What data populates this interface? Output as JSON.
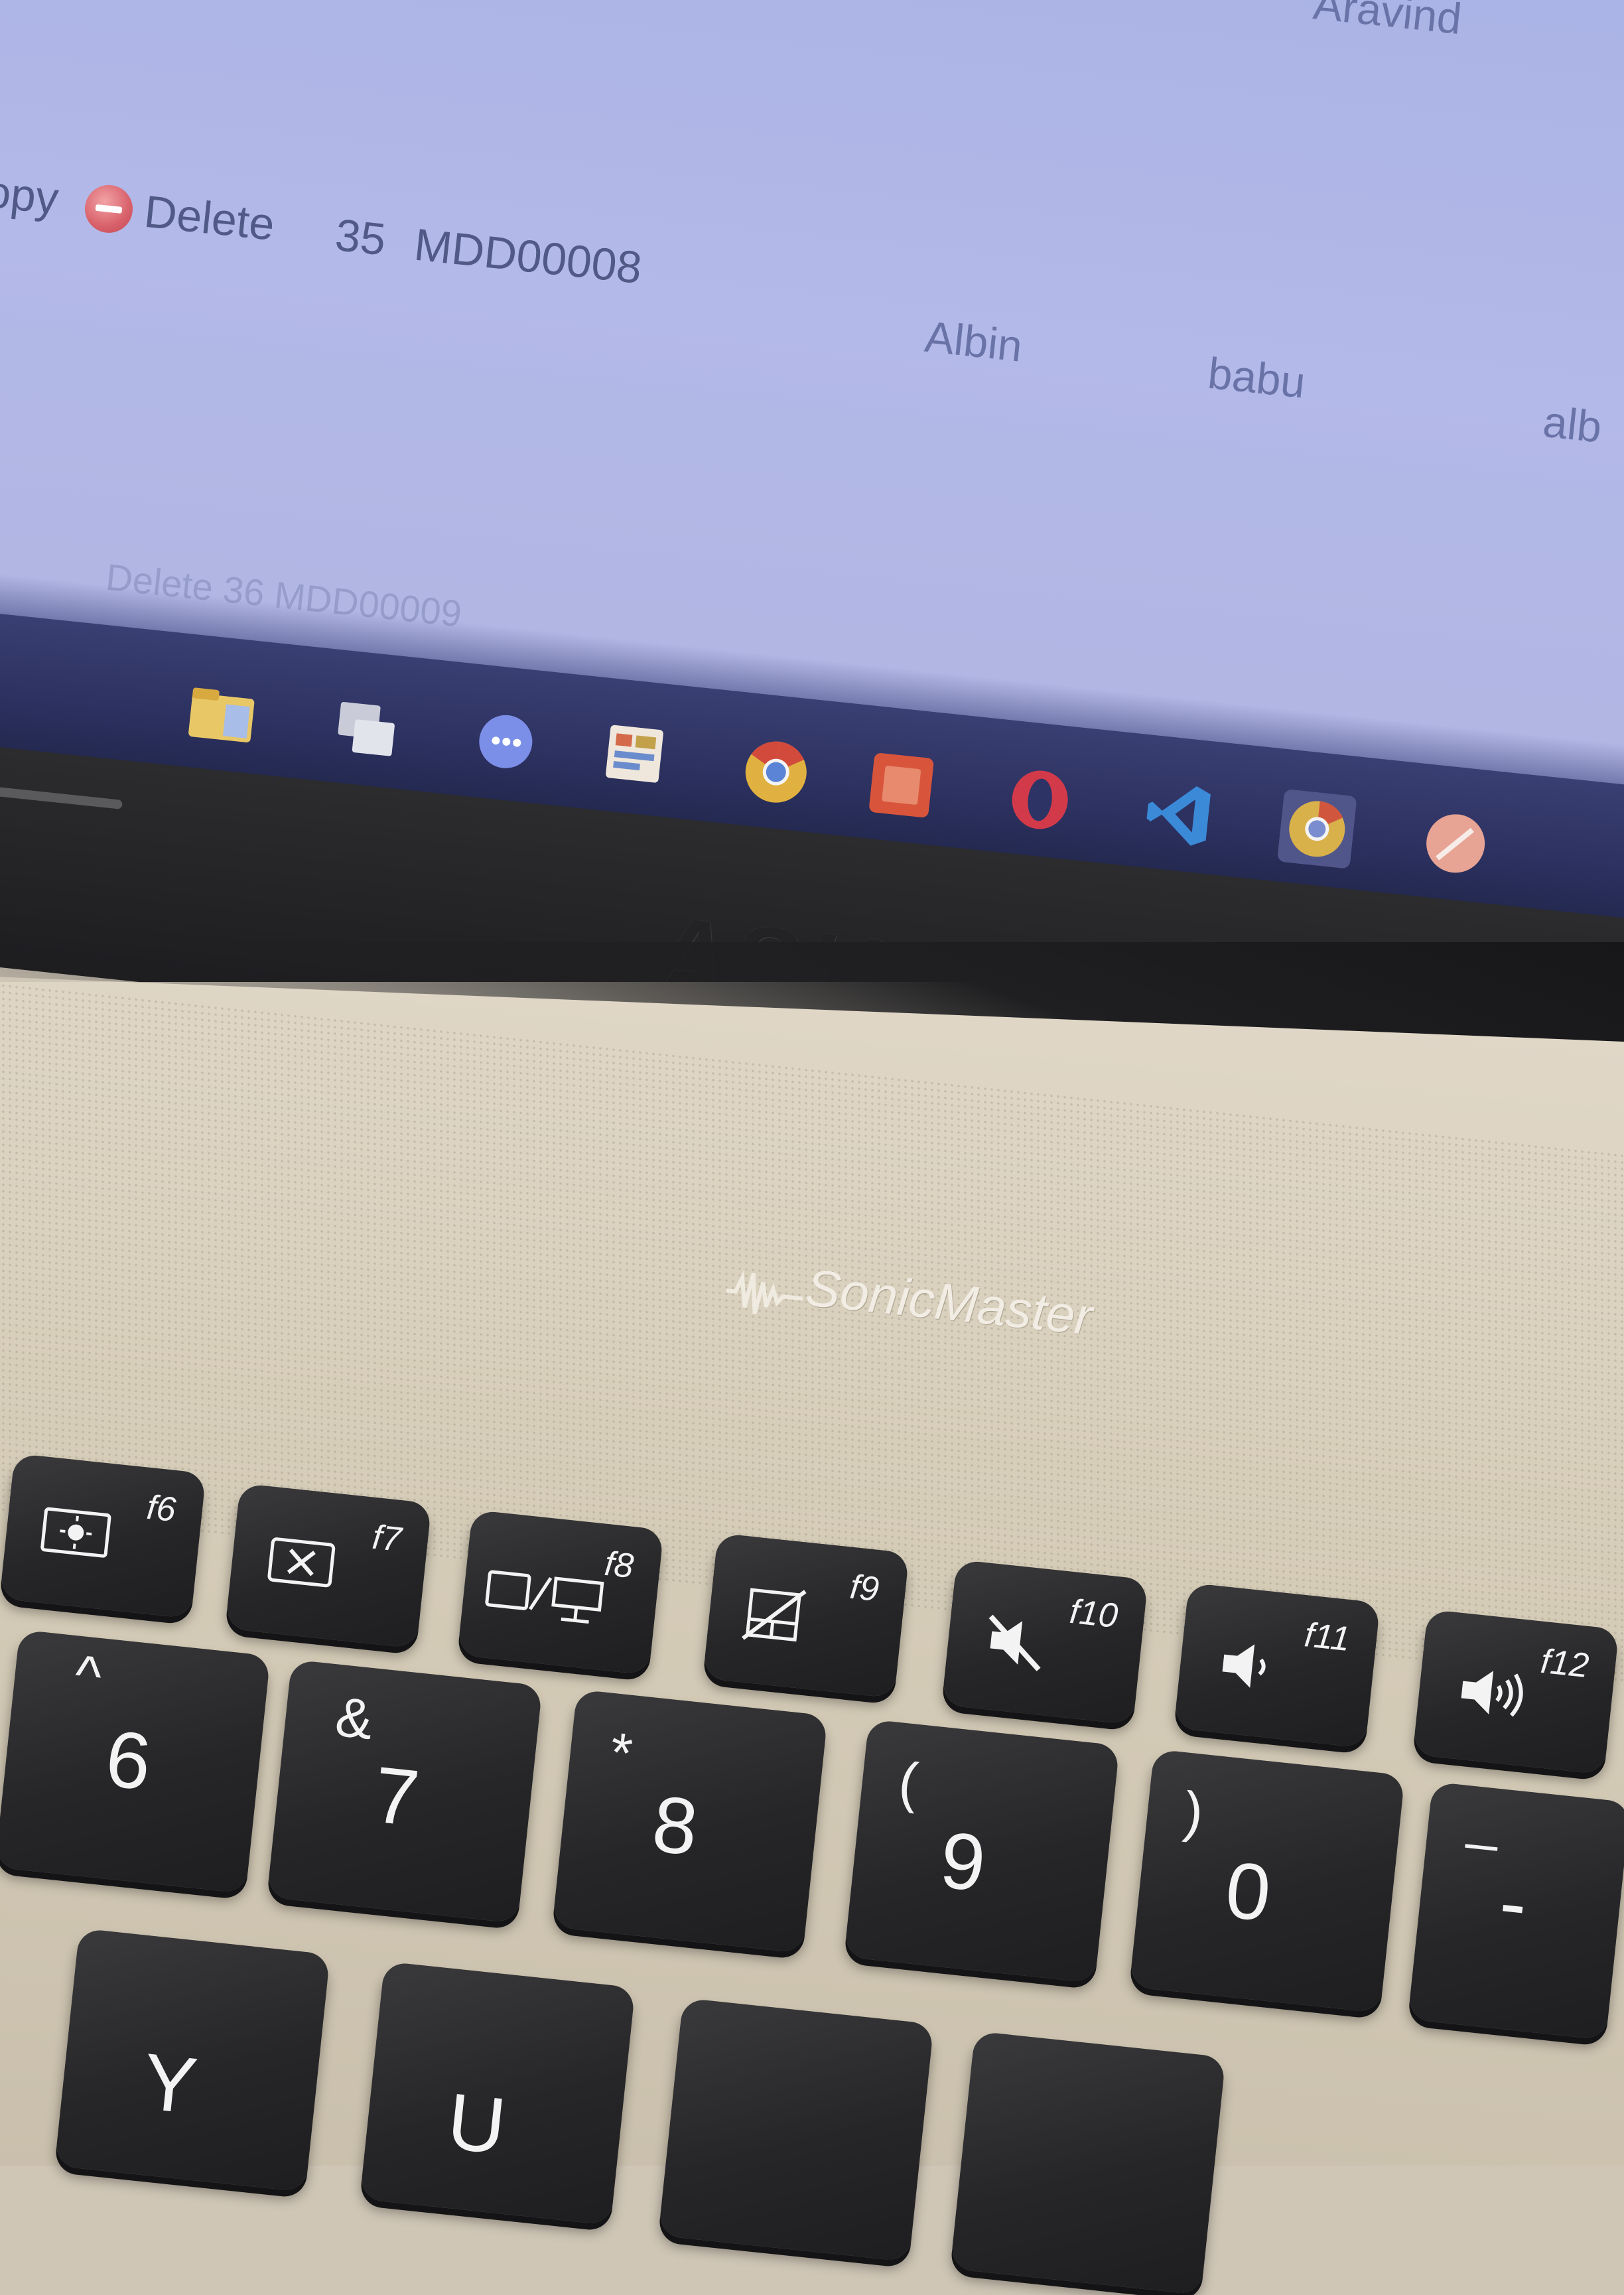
{
  "screen": {
    "top_name": "Aravind",
    "row": {
      "copy_label": "Copy",
      "delete_label": "Delete",
      "id": "35",
      "code": "MDD00008",
      "first_name": "Albin",
      "last_name": "babu",
      "email_partial": "alb"
    },
    "faint_next_row": "Delete  36  MDD00009",
    "taskbar_icons": [
      "file-explorer-icon",
      "task-view-icon",
      "chat-icon",
      "app-grid-icon",
      "chrome-icon",
      "office-icon",
      "opera-icon",
      "vscode-icon",
      "chrome-canary-icon",
      "edit-icon"
    ]
  },
  "laptop": {
    "brand": "ASUS",
    "speaker_brand": "SonicMaster"
  },
  "keyboard": {
    "function_keys": [
      {
        "label": "f6",
        "icon": "brightness-icon"
      },
      {
        "label": "f7",
        "icon": "display-off-icon"
      },
      {
        "label": "f8",
        "icon": "projector-switch-icon"
      },
      {
        "label": "f9",
        "icon": "touchpad-toggle-icon"
      },
      {
        "label": "f10",
        "icon": "mute-icon"
      },
      {
        "label": "f11",
        "icon": "volume-down-icon"
      },
      {
        "label": "f12",
        "icon": "volume-up-icon"
      }
    ],
    "number_keys": [
      {
        "shift": "^",
        "main": "6"
      },
      {
        "shift": "&",
        "main": "7"
      },
      {
        "shift": "*",
        "main": "8"
      },
      {
        "shift": "(",
        "main": "9"
      },
      {
        "shift": ")",
        "main": "0"
      },
      {
        "shift": "_",
        "main": "-"
      }
    ],
    "letter_keys": [
      "Y",
      "U"
    ]
  }
}
